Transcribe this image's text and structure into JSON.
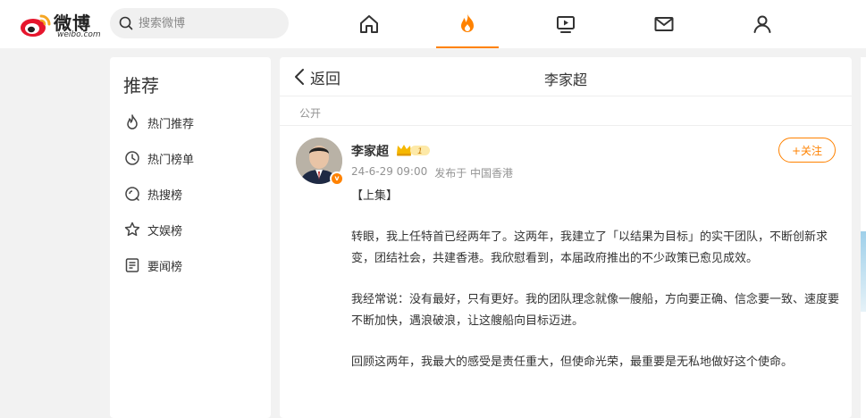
{
  "header": {
    "logo_text": "微博",
    "logo_sub": "weibo.com",
    "search_placeholder": "搜索微博",
    "nav": [
      "home-icon",
      "hot-icon",
      "video-icon",
      "mail-icon",
      "profile-icon"
    ],
    "active_nav": "hot-icon",
    "accent": "#ff8200"
  },
  "sidebar": {
    "title": "推荐",
    "items": [
      {
        "label": "热门推荐",
        "icon": "flame-icon"
      },
      {
        "label": "热门榜单",
        "icon": "clock-icon"
      },
      {
        "label": "热搜榜",
        "icon": "search-circle-icon"
      },
      {
        "label": "文娱榜",
        "icon": "star-icon"
      },
      {
        "label": "要闻榜",
        "icon": "news-icon"
      }
    ]
  },
  "main": {
    "back_label": "返回",
    "title": "李家超",
    "visibility": "公开",
    "post": {
      "author": "李家超",
      "level_badge": "1",
      "time": "24-6-29 09:00",
      "source": "发布于 中国香港",
      "follow_label": "+关注",
      "paragraphs": [
        "【上集】",
        "转眼，我上任特首已经两年了。这两年，我建立了「以结果为目标」的实干团队，不断创新求变，团结社会，共建香港。我欣慰看到，本届政府推出的不少政策已愈见成效。",
        "我经常说：没有最好，只有更好。我的团队理念就像一艘船，方向要正确、信念要一致、速度要不断加快，遇浪破浪，让这艘船向目标迈进。",
        "回顾这两年，我最大的感受是责任重大，但使命光荣，最重要是无私地做好这个使命。"
      ]
    }
  }
}
